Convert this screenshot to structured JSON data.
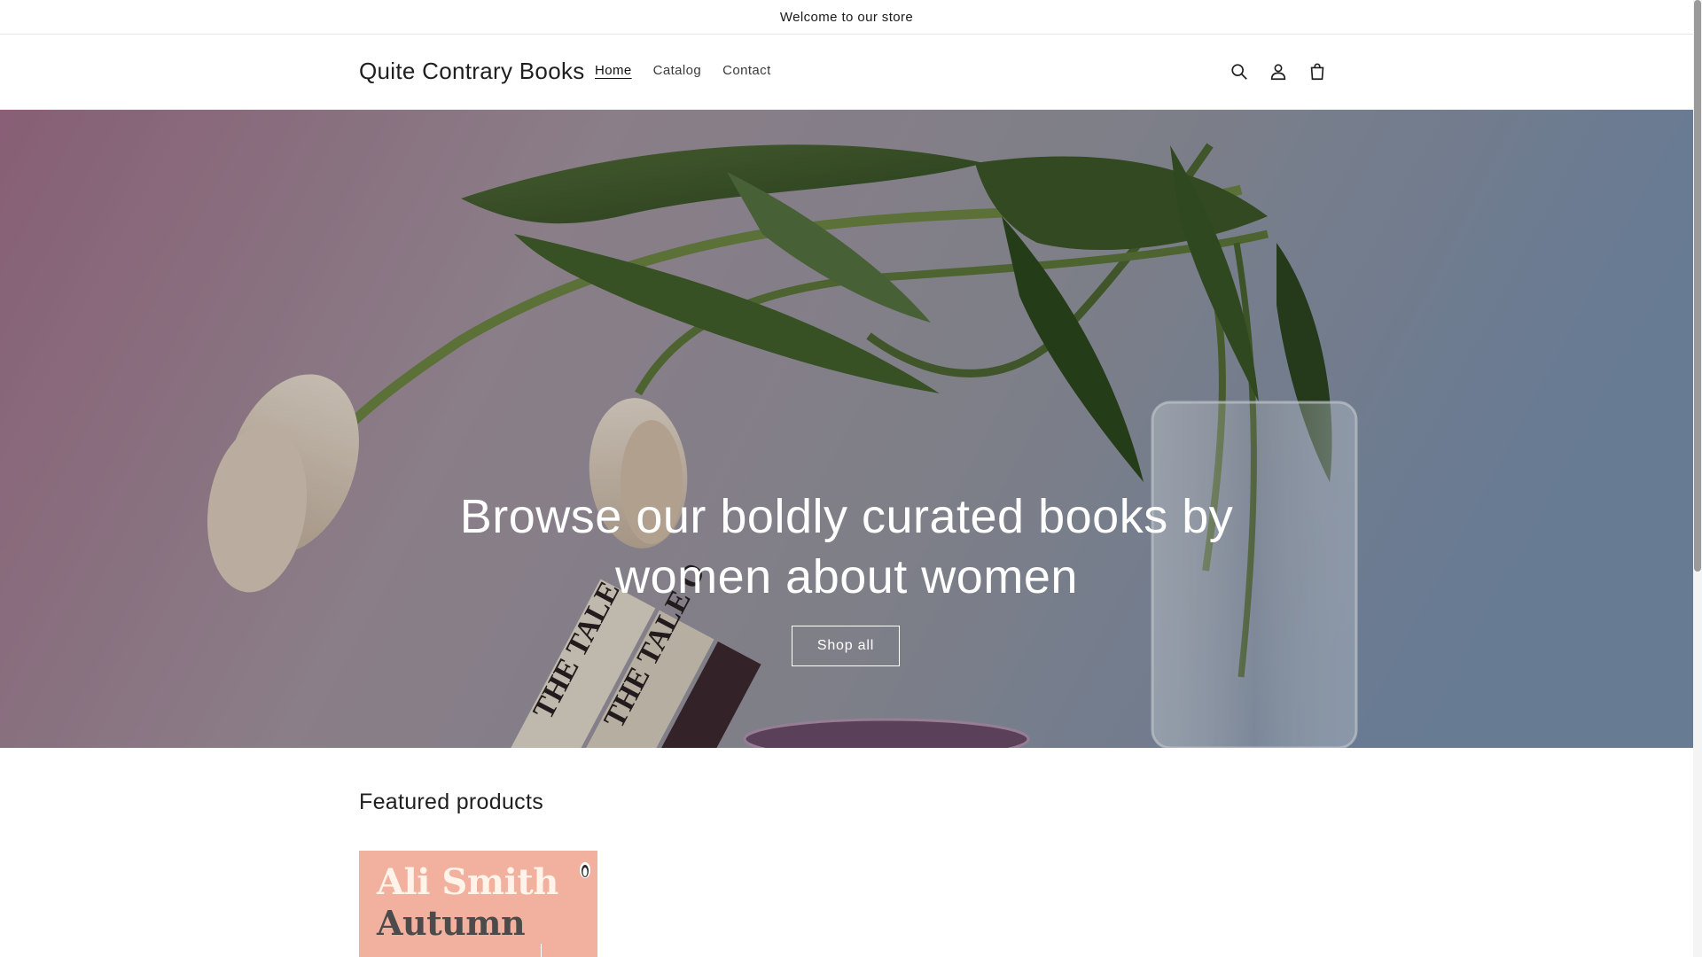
{
  "announcement": {
    "text": "Welcome to our store"
  },
  "header": {
    "logo": "Quite Contrary Books",
    "nav": [
      {
        "label": "Home",
        "active": true
      },
      {
        "label": "Catalog",
        "active": false
      },
      {
        "label": "Contact",
        "active": false
      }
    ],
    "icons": [
      "search-icon",
      "account-icon",
      "cart-icon"
    ]
  },
  "hero": {
    "title": "Browse our boldly curated books by women about women",
    "button_label": "Shop all",
    "book_spine_1": "THE TALE",
    "book_spine_2": "THE TALE O"
  },
  "featured": {
    "heading": "Featured products",
    "products": [
      {
        "author": "Ali Smith",
        "title": "Autumn"
      }
    ]
  },
  "colors": {
    "hero_gradient_left": "#9d6f93",
    "hero_gradient_right": "#7f93ad",
    "product_cover": "#f2b19e"
  }
}
